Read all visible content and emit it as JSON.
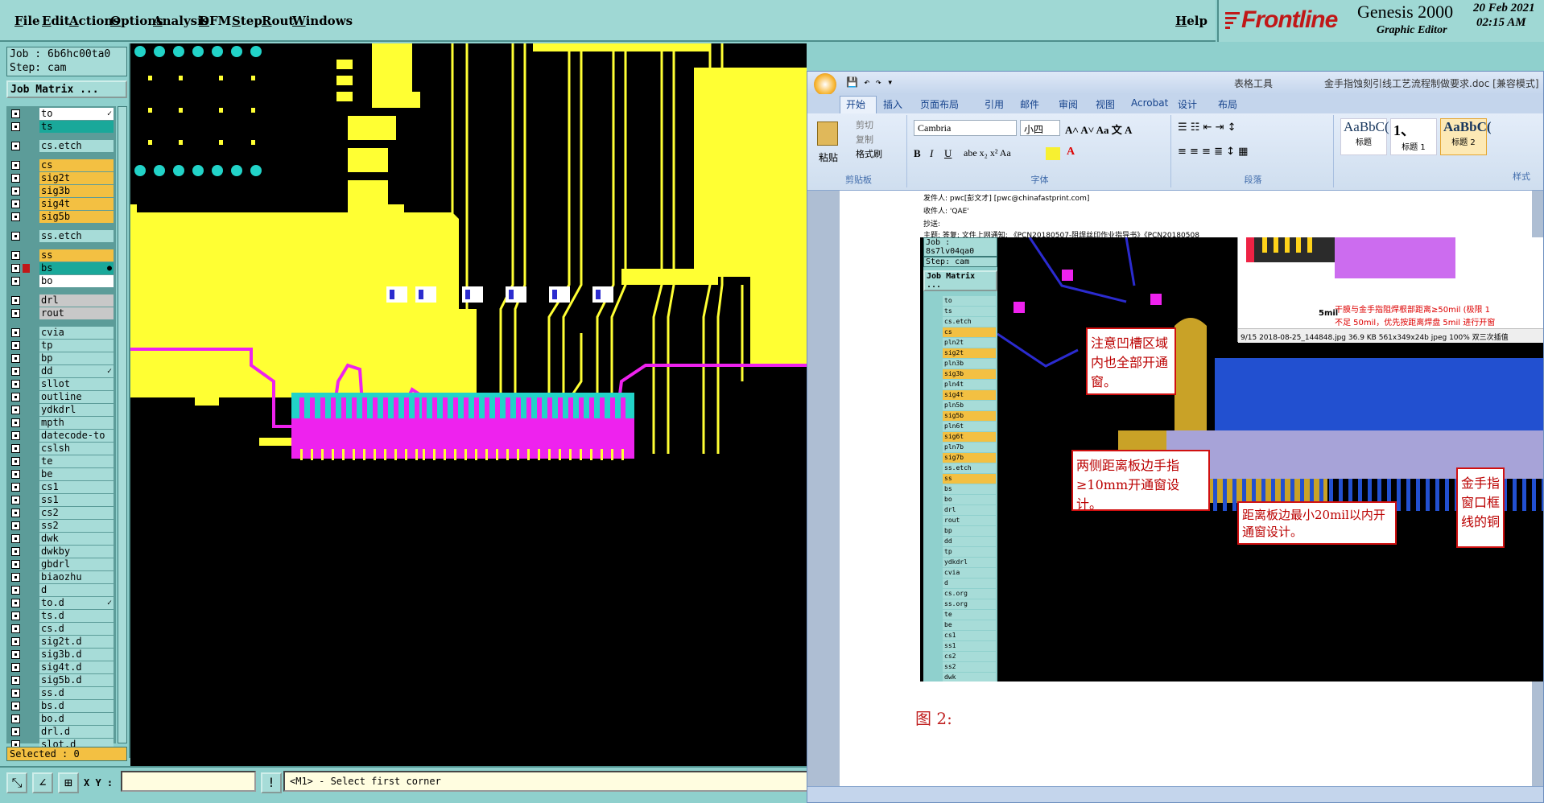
{
  "menubar": {
    "items": [
      "File",
      "Edit",
      "Actions",
      "Options",
      "Analysis",
      "DFM",
      "Step",
      "Rout",
      "Windows"
    ],
    "help": "Help"
  },
  "brand": {
    "logo": "Frontline",
    "product": "Genesis 2000",
    "subtitle": "Graphic Editor",
    "date": "20 Feb 2021",
    "time": "02:15 AM",
    "accent": "#c01818"
  },
  "job": {
    "job_label": "Job : 6b6hc00ta0",
    "step_label": "Step: cam",
    "matrix_button": "Job Matrix ..."
  },
  "layers": [
    {
      "name": "to",
      "color": "#ffffff",
      "mark": "✓"
    },
    {
      "name": "ts",
      "color": "#1aa89a"
    },
    {
      "name": "cs.etch",
      "color": "#a7dcd8"
    },
    {
      "name": "cs",
      "color": "#f3c042"
    },
    {
      "name": "sig2t",
      "color": "#f3c042"
    },
    {
      "name": "sig3b",
      "color": "#f3c042"
    },
    {
      "name": "sig4t",
      "color": "#f3c042"
    },
    {
      "name": "sig5b",
      "color": "#f3c042"
    },
    {
      "name": "ss.etch",
      "color": "#a7dcd8"
    },
    {
      "name": "ss",
      "color": "#f3c042"
    },
    {
      "name": "bs",
      "color": "#1aa89a",
      "mark": "●"
    },
    {
      "name": "bo",
      "color": "#ffffff"
    },
    {
      "name": "drl",
      "color": "#c8c8c8"
    },
    {
      "name": "rout",
      "color": "#c8c8c8"
    },
    {
      "name": "cvia",
      "color": "#a7dcd8"
    },
    {
      "name": "tp",
      "color": "#a7dcd8"
    },
    {
      "name": "bp",
      "color": "#a7dcd8"
    },
    {
      "name": "dd",
      "color": "#a7dcd8",
      "mark": "✓"
    },
    {
      "name": "sllot",
      "color": "#a7dcd8"
    },
    {
      "name": "outline",
      "color": "#a7dcd8"
    },
    {
      "name": "ydkdrl",
      "color": "#a7dcd8"
    },
    {
      "name": "mpth",
      "color": "#a7dcd8"
    },
    {
      "name": "datecode-to",
      "color": "#a7dcd8"
    },
    {
      "name": "cslsh",
      "color": "#a7dcd8"
    },
    {
      "name": "te",
      "color": "#a7dcd8"
    },
    {
      "name": "be",
      "color": "#a7dcd8"
    },
    {
      "name": "cs1",
      "color": "#a7dcd8"
    },
    {
      "name": "ss1",
      "color": "#a7dcd8"
    },
    {
      "name": "cs2",
      "color": "#a7dcd8"
    },
    {
      "name": "ss2",
      "color": "#a7dcd8"
    },
    {
      "name": "dwk",
      "color": "#a7dcd8"
    },
    {
      "name": "dwkby",
      "color": "#a7dcd8"
    },
    {
      "name": "gbdrl",
      "color": "#a7dcd8"
    },
    {
      "name": "biaozhu",
      "color": "#a7dcd8"
    },
    {
      "name": "d",
      "color": "#a7dcd8"
    },
    {
      "name": "to.d",
      "color": "#a7dcd8",
      "mark": "✓"
    },
    {
      "name": "ts.d",
      "color": "#a7dcd8"
    },
    {
      "name": "cs.d",
      "color": "#a7dcd8"
    },
    {
      "name": "sig2t.d",
      "color": "#a7dcd8"
    },
    {
      "name": "sig3b.d",
      "color": "#a7dcd8"
    },
    {
      "name": "sig4t.d",
      "color": "#a7dcd8"
    },
    {
      "name": "sig5b.d",
      "color": "#a7dcd8"
    },
    {
      "name": "ss.d",
      "color": "#a7dcd8"
    },
    {
      "name": "bs.d",
      "color": "#a7dcd8"
    },
    {
      "name": "bo.d",
      "color": "#a7dcd8"
    },
    {
      "name": "drl.d",
      "color": "#a7dcd8"
    },
    {
      "name": "slot.d",
      "color": "#a7dcd8"
    }
  ],
  "selected": "Selected : 0",
  "bottom": {
    "xy_label": "X Y :",
    "xy_value": "",
    "status": "<M1> - Select first corner"
  },
  "word": {
    "title": "金手指蚀刻引线工艺流程制做要求.doc [兼容模式]",
    "context_tab": "表格工具",
    "tabs": [
      "开始",
      "插入",
      "页面布局",
      "引用",
      "邮件",
      "审阅",
      "视图",
      "Acrobat",
      "设计",
      "布局"
    ],
    "clipboard": {
      "paste": "粘贴",
      "cut": "剪切",
      "copy": "复制",
      "format": "格式刷",
      "group": "剪贴板"
    },
    "font": {
      "name": "Cambria",
      "size": "小四",
      "group": "字体"
    },
    "paragraph": {
      "group": "段落"
    },
    "styles": {
      "s1": "AaBbC(",
      "s1_lbl": "标题",
      "s2": "1、",
      "s2_lbl": "标题 1",
      "s3": "AaBbC(",
      "s3_lbl": "标题 2",
      "group": "样式"
    },
    "email": {
      "from": "发件人: pwc[彭文才] [pwc@chinafastprint.com]",
      "to": "收件人: 'QAE'",
      "cc": "抄送:",
      "subject": "主题:    答复: 文件上网通知: 《PCN20180507-阻焊丝印作业指导书》《PCN20180508"
    },
    "note1": "注意凹槽区域内也全部开通窗。",
    "note2": "两侧距离板边手指≥10mm开通窗设计。",
    "note3": "距离板边最小20mil以内开通窗设计。",
    "note4": "金手指窗口框线的铜",
    "side_note": "干膜与金手指阻焊根部距离≥50mil (极限 1",
    "side_note2": "不足 50mil，优先按距离焊盘 5mil 进行开窗",
    "dim_label": "5mil",
    "imgbar": "9/15   2018-08-25_144848.jpg   36.9 KB   561x349x24b jpeg   100%   双三次插值",
    "figure": "图 2:",
    "inner_job": "Job : 8s7lv04qa0",
    "inner_step": "Step: cam",
    "inner_matrix": "Job Matrix ...",
    "inner_layers": [
      "to",
      "ts",
      "cs.etch",
      "cs",
      "pln2t",
      "sig2t",
      "pln3b",
      "sig3b",
      "pln4t",
      "sig4t",
      "pln5b",
      "sig5b",
      "pln6t",
      "sig6t",
      "pln7b",
      "sig7b",
      "ss.etch",
      "ss",
      "bs",
      "bo",
      "drl",
      "rout",
      "bp",
      "dd",
      "tp",
      "ydkdrl",
      "cvia",
      "d",
      "cs.org",
      "ss.org",
      "te",
      "be",
      "cs1",
      "ss1",
      "cs2",
      "ss2",
      "dwk"
    ]
  }
}
